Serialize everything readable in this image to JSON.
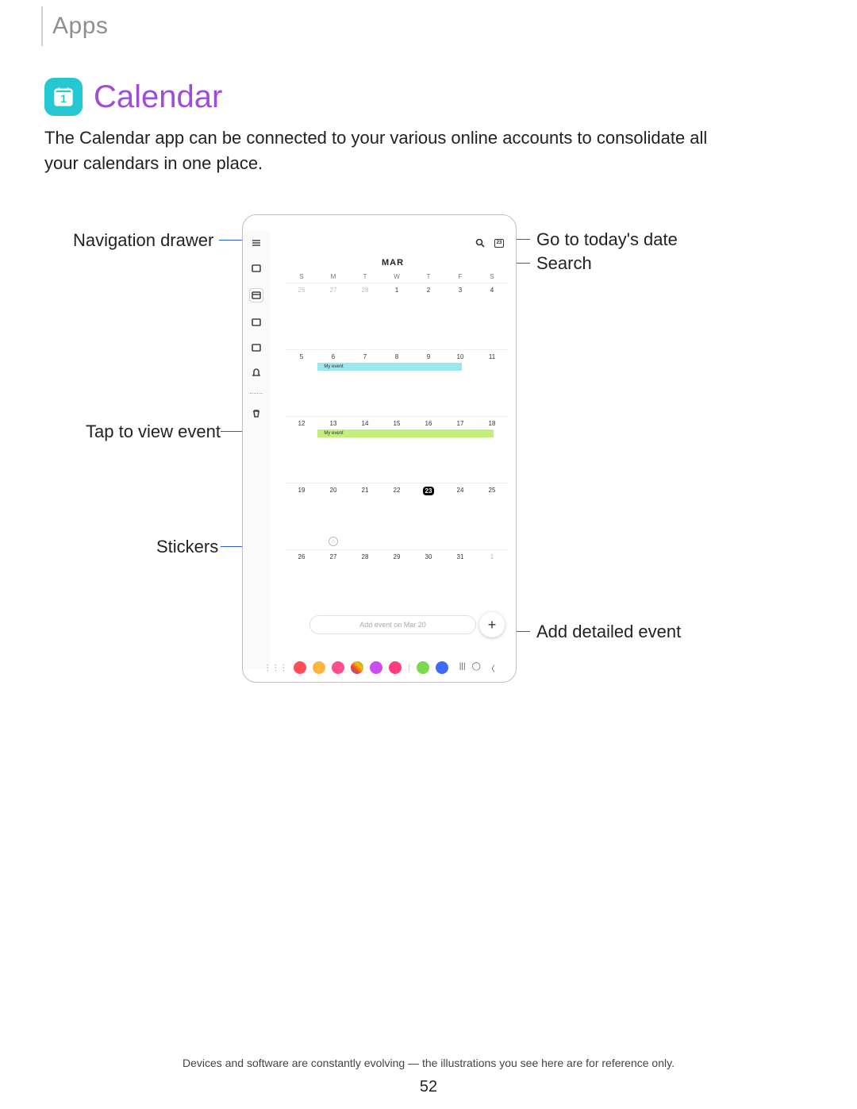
{
  "header": "Apps",
  "title": "Calendar",
  "description": "The Calendar app can be connected to your various online accounts to consolidate all your calendars in one place.",
  "callouts": {
    "nav_drawer": "Navigation drawer",
    "today": "Go to today's date",
    "search": "Search",
    "tap_event": "Tap to view event",
    "stickers": "Stickers",
    "add_event": "Add detailed event"
  },
  "calendar": {
    "month": "MAR",
    "day_headers": [
      "S",
      "M",
      "T",
      "W",
      "T",
      "F",
      "S"
    ],
    "weeks": [
      [
        "26",
        "27",
        "28",
        "1",
        "2",
        "3",
        "4"
      ],
      [
        "5",
        "6",
        "7",
        "8",
        "9",
        "10",
        "11"
      ],
      [
        "12",
        "13",
        "14",
        "15",
        "16",
        "17",
        "18"
      ],
      [
        "19",
        "20",
        "21",
        "22",
        "23",
        "24",
        "25"
      ],
      [
        "26",
        "27",
        "28",
        "29",
        "30",
        "31",
        "1"
      ]
    ],
    "event1_label": "My event",
    "event2_label": "My event",
    "today_num": "23",
    "quick_add": "Add event on Mar 20"
  },
  "footer": "Devices and software are constantly evolving — the illustrations you see here are for reference only.",
  "page": "52"
}
